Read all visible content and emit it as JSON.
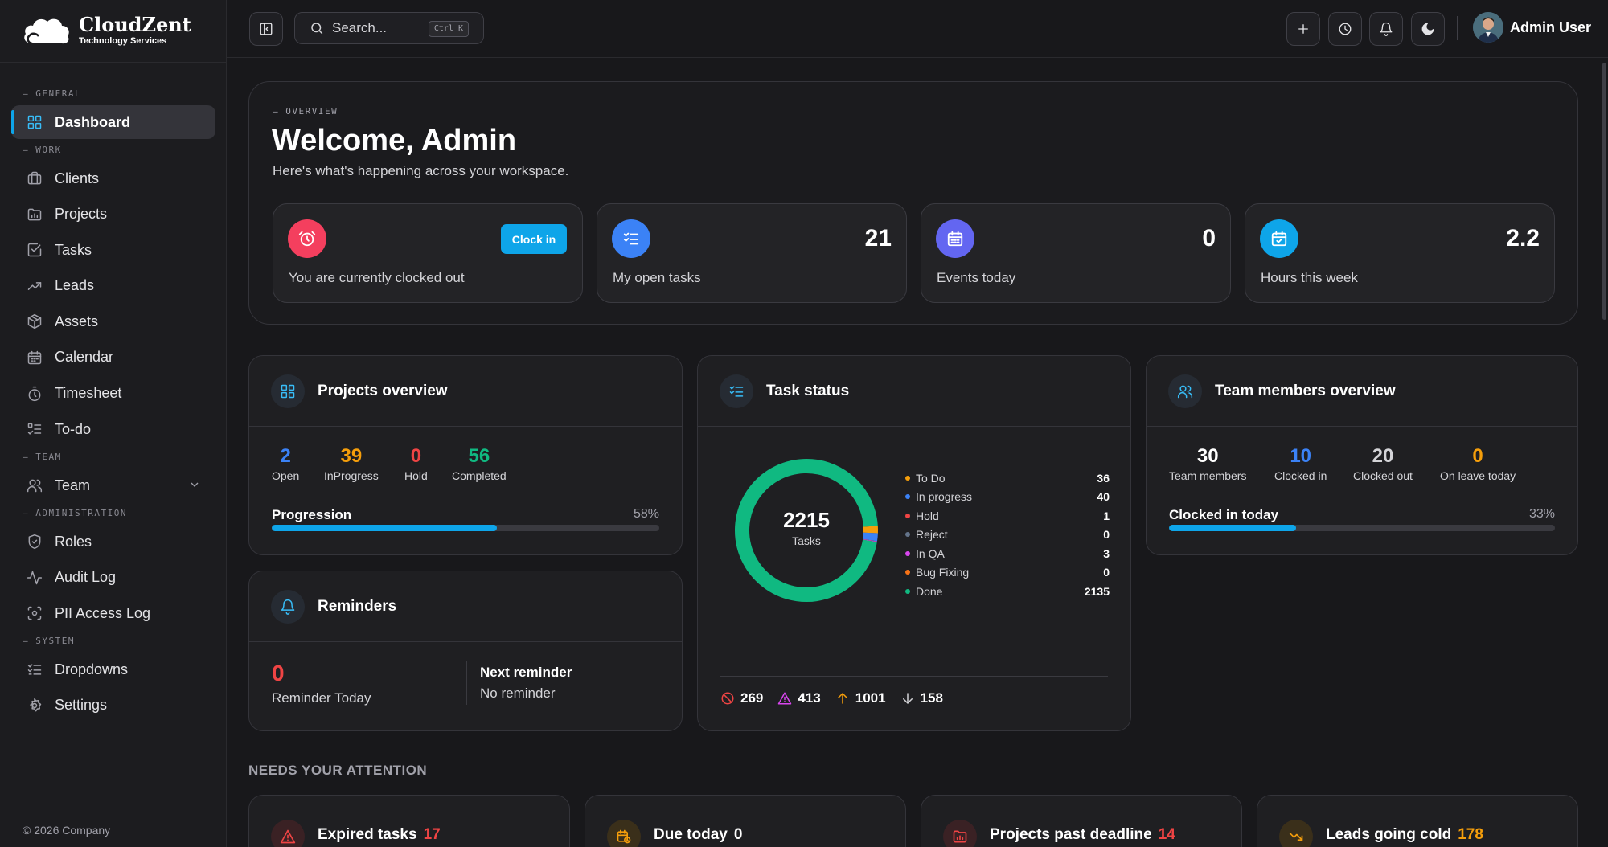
{
  "brand": {
    "name": "CloudZent",
    "tagline": "Technology Services"
  },
  "sidebar": {
    "sections": [
      {
        "label": "— GENERAL",
        "items": [
          {
            "label": "Dashboard",
            "icon": "dashboard-icon",
            "active": true
          }
        ]
      },
      {
        "label": "— WORK",
        "items": [
          {
            "label": "Clients",
            "icon": "briefcase-icon"
          },
          {
            "label": "Projects",
            "icon": "folder-icon"
          },
          {
            "label": "Tasks",
            "icon": "check-square-icon"
          },
          {
            "label": "Leads",
            "icon": "trending-up-icon"
          },
          {
            "label": "Assets",
            "icon": "box-icon"
          },
          {
            "label": "Calendar",
            "icon": "calendar-icon"
          },
          {
            "label": "Timesheet",
            "icon": "timer-icon"
          },
          {
            "label": "To-do",
            "icon": "list-todo-icon"
          }
        ]
      },
      {
        "label": "— TEAM",
        "items": [
          {
            "label": "Team",
            "icon": "users-icon",
            "expandable": true
          }
        ]
      },
      {
        "label": "— ADMINISTRATION",
        "items": [
          {
            "label": "Roles",
            "icon": "shield-icon"
          },
          {
            "label": "Audit Log",
            "icon": "activity-icon"
          },
          {
            "label": "PII Access Log",
            "icon": "scan-eye-icon"
          }
        ]
      },
      {
        "label": "— SYSTEM",
        "items": [
          {
            "label": "Dropdowns",
            "icon": "list-check-icon"
          },
          {
            "label": "Settings",
            "icon": "gear-icon"
          }
        ]
      }
    ],
    "footer": "© 2026 Company"
  },
  "topbar": {
    "search_placeholder": "Search...",
    "search_shortcut": "Ctrl K",
    "user_name": "Admin User"
  },
  "overview": {
    "label": "— OVERVIEW",
    "title": "Welcome, Admin",
    "subtitle": "Here's what's happening across your workspace.",
    "clock_status": "You are currently clocked out",
    "clock_button": "Clock in",
    "stats": [
      {
        "label": "My open tasks",
        "value": "21",
        "color": "#3b82f6"
      },
      {
        "label": "Events today",
        "value": "0",
        "color": "#6366f1"
      },
      {
        "label": "Hours this week",
        "value": "2.2",
        "color": "#0ea5e9"
      }
    ]
  },
  "projects": {
    "title": "Projects overview",
    "metrics": [
      {
        "value": "2",
        "label": "Open",
        "color": "#3b82f6"
      },
      {
        "value": "39",
        "label": "InProgress",
        "color": "#f59e0b"
      },
      {
        "value": "0",
        "label": "Hold",
        "color": "#ef4444"
      },
      {
        "value": "56",
        "label": "Completed",
        "color": "#10b981"
      }
    ],
    "progress_label": "Progression",
    "progress_pct": "58%",
    "progress_value": 0.58
  },
  "reminders": {
    "title": "Reminders",
    "count": "0",
    "count_label": "Reminder Today",
    "next_label": "Next reminder",
    "next_value": "No reminder"
  },
  "task_status": {
    "title": "Task status",
    "total": "2215",
    "total_label": "Tasks",
    "legend": [
      {
        "label": "To Do",
        "value": "36",
        "color": "#f59e0b"
      },
      {
        "label": "In progress",
        "value": "40",
        "color": "#3b82f6"
      },
      {
        "label": "Hold",
        "value": "1",
        "color": "#ef4444"
      },
      {
        "label": "Reject",
        "value": "0",
        "color": "#64748b"
      },
      {
        "label": "In QA",
        "value": "3",
        "color": "#d946ef"
      },
      {
        "label": "Bug Fixing",
        "value": "0",
        "color": "#f97316"
      },
      {
        "label": "Done",
        "value": "2135",
        "color": "#10b981"
      }
    ],
    "footer": [
      {
        "value": "269",
        "icon": "ban-icon",
        "color": "#ef4444"
      },
      {
        "value": "413",
        "icon": "alert-triangle-icon",
        "color": "#d946ef"
      },
      {
        "value": "1001",
        "icon": "arrow-up-icon",
        "color": "#f59e0b"
      },
      {
        "value": "158",
        "icon": "arrow-down-icon",
        "color": "#d4d4d8"
      }
    ]
  },
  "team": {
    "title": "Team members overview",
    "metrics": [
      {
        "value": "30",
        "label": "Team members",
        "color": "#ffffff"
      },
      {
        "value": "10",
        "label": "Clocked in",
        "color": "#3b82f6"
      },
      {
        "value": "20",
        "label": "Clocked out",
        "color": "#d4d4d8"
      },
      {
        "value": "0",
        "label": "On leave today",
        "color": "#f59e0b"
      }
    ],
    "progress_label": "Clocked in today",
    "progress_pct": "33%",
    "progress_value": 0.33
  },
  "attention": {
    "title": "NEEDS YOUR ATTENTION",
    "cards": [
      {
        "title": "Expired tasks",
        "count": "17",
        "color": "#ef4444",
        "bg": "#3a2124",
        "icon": "alert-triangle-icon"
      },
      {
        "title": "Due today",
        "count": "0",
        "color": "#f59e0b",
        "bg": "#3a2f1a",
        "icon": "calendar-clock-icon"
      },
      {
        "title": "Projects past deadline",
        "count": "14",
        "color": "#ef4444",
        "bg": "#3a2124",
        "icon": "folder-alert-icon"
      },
      {
        "title": "Leads going cold",
        "count": "178",
        "color": "#f59e0b",
        "bg": "#3a2f1a",
        "icon": "trending-down-icon"
      }
    ]
  }
}
